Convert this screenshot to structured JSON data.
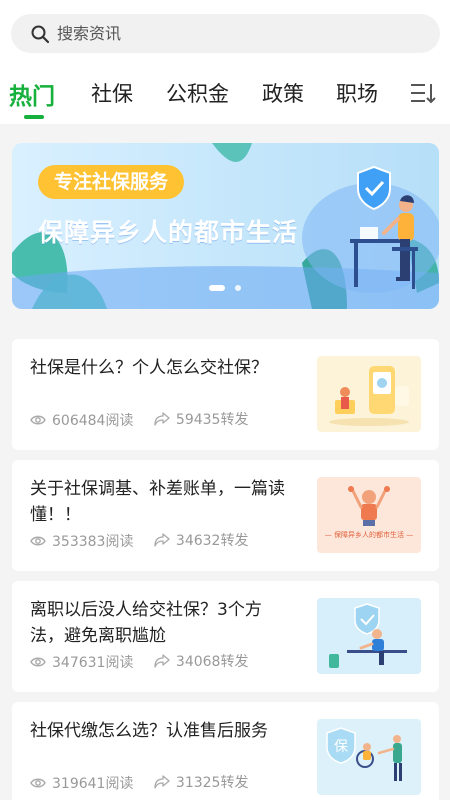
{
  "search": {
    "placeholder": "搜索资讯",
    "icon": "search-icon"
  },
  "tabs": [
    {
      "label": "热门",
      "active": true
    },
    {
      "label": "社保",
      "active": false
    },
    {
      "label": "公积金",
      "active": false
    },
    {
      "label": "政策",
      "active": false
    },
    {
      "label": "职场",
      "active": false
    }
  ],
  "tab_more_icon": "list-sort-icon",
  "accent_color": "#16b03c",
  "banner": {
    "tag": "专注社保服务",
    "title": "保障异乡人的都市生活",
    "slide_count": 2,
    "active_slide": 1
  },
  "articles": [
    {
      "title": "社保是什么？个人怎么交社保？",
      "reads": "606484阅读",
      "shares": "59435转发",
      "thumb": "thumb-social-security-phone"
    },
    {
      "title": "关于社保调基、补差账单，一篇读懂！！",
      "reads": "353383阅读",
      "shares": "34632转发",
      "thumb": "thumb-banner-poster",
      "thumb_text": "— 保障异乡人的都市生活 —"
    },
    {
      "title": "离职以后没人给交社保？3个方法，避免离职尴尬",
      "reads": "347631阅读",
      "shares": "34068转发",
      "thumb": "thumb-worker-desk"
    },
    {
      "title": "社保代缴怎么选？认准售后服务",
      "reads": "319641阅读",
      "shares": "31325转发",
      "thumb": "thumb-wheelchair",
      "thumb_text": "保"
    }
  ]
}
